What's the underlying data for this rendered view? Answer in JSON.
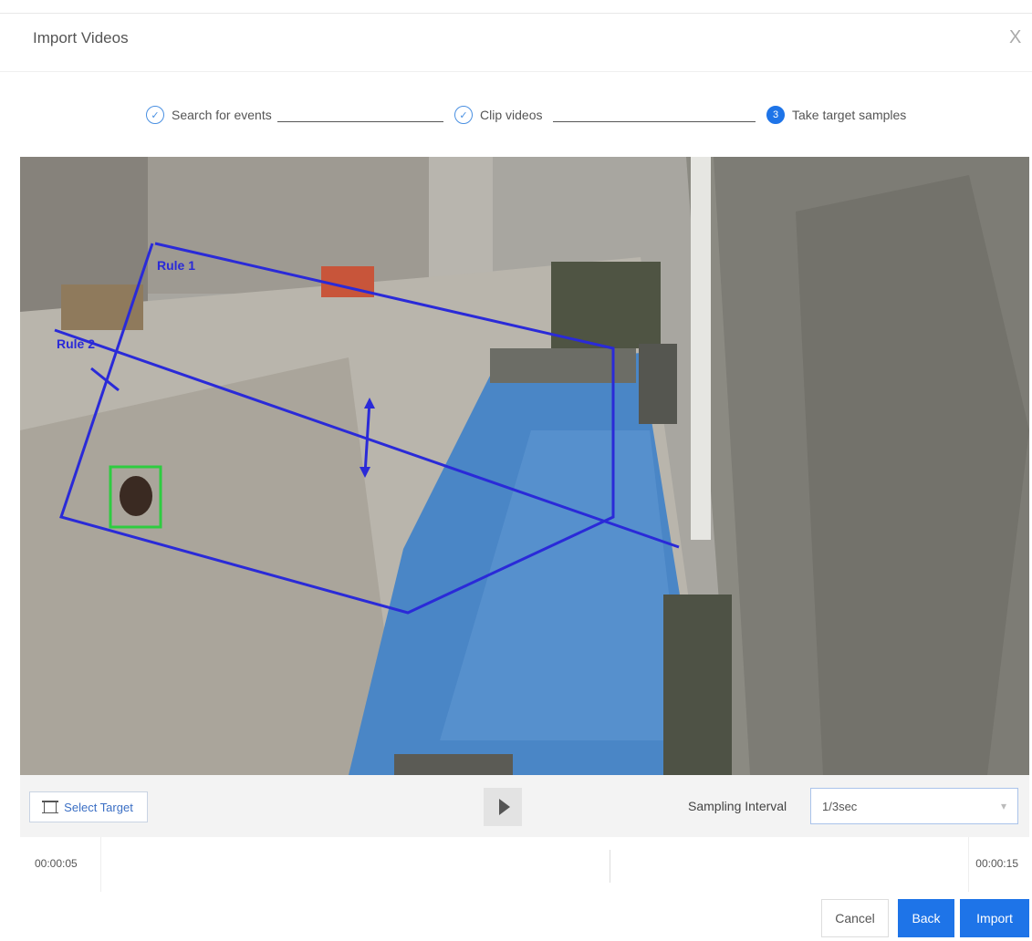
{
  "dialog": {
    "title": "Import Videos",
    "close_glyph": "X"
  },
  "steps": [
    {
      "label": "Search for events",
      "status": "done",
      "marker": "✓"
    },
    {
      "label": "Clip videos",
      "status": "done",
      "marker": "✓"
    },
    {
      "label": "Take target samples",
      "status": "active",
      "marker": "3"
    }
  ],
  "video": {
    "overlay_lines": [
      {
        "label": "Rule 1"
      },
      {
        "label": "Rule 2"
      }
    ],
    "overlay_color": "#2a2ad8",
    "target_box_color": "#2ecc40"
  },
  "controls": {
    "select_target_label": "Select Target",
    "play_icon": "play-icon",
    "sampling_interval_label": "Sampling Interval",
    "sampling_interval_value": "1/3sec"
  },
  "timeline": {
    "start_time": "00:00:05",
    "end_time": "00:00:15"
  },
  "footer": {
    "cancel_label": "Cancel",
    "back_label": "Back",
    "import_label": "Import"
  },
  "colors": {
    "primary": "#1e74e8"
  }
}
